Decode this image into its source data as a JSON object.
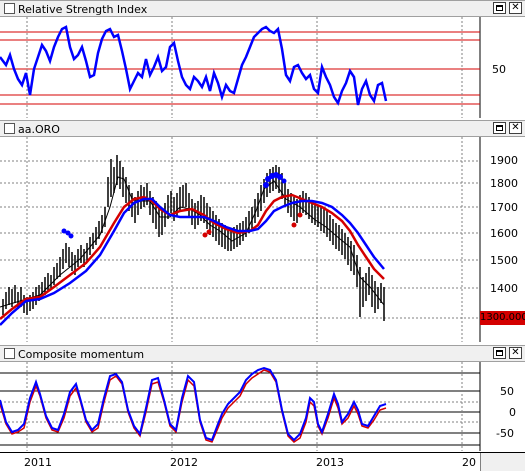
{
  "panes": {
    "rsi": {
      "title": "Relative Strength Index",
      "axis_labels": [
        "50"
      ]
    },
    "price": {
      "title": "aa.ORO",
      "axis_labels": [
        "1900",
        "1800",
        "1700",
        "1600",
        "1500",
        "1400"
      ],
      "last_price": "1300.000"
    },
    "momentum": {
      "title": "Composite momentum",
      "axis_labels": [
        "50",
        "0",
        "-50"
      ]
    }
  },
  "time_axis": {
    "labels": [
      "2011",
      "2012",
      "2013",
      "20"
    ]
  },
  "buttons": {
    "restore": "□",
    "close": "✕"
  },
  "colors": {
    "rsi_line": "#0000ff",
    "level_line": "#d40000",
    "candles": "#000000",
    "ma_fast": "#0000ff",
    "ma_slow": "#d40000",
    "thin_ma": "#000000",
    "buy_dot": "#0000ff",
    "sell_dot": "#d40000",
    "momentum_blue": "#0000ff",
    "momentum_red": "#d40000"
  }
}
